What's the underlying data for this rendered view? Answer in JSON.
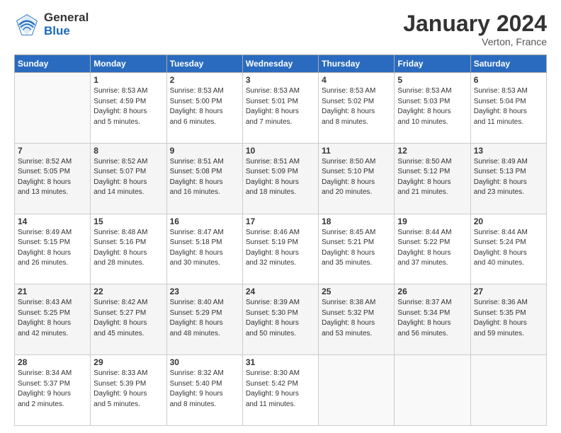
{
  "logo": {
    "general": "General",
    "blue": "Blue"
  },
  "title": "January 2024",
  "location": "Verton, France",
  "weekdays": [
    "Sunday",
    "Monday",
    "Tuesday",
    "Wednesday",
    "Thursday",
    "Friday",
    "Saturday"
  ],
  "weeks": [
    [
      {
        "day": "",
        "info": ""
      },
      {
        "day": "1",
        "info": "Sunrise: 8:53 AM\nSunset: 4:59 PM\nDaylight: 8 hours\nand 5 minutes."
      },
      {
        "day": "2",
        "info": "Sunrise: 8:53 AM\nSunset: 5:00 PM\nDaylight: 8 hours\nand 6 minutes."
      },
      {
        "day": "3",
        "info": "Sunrise: 8:53 AM\nSunset: 5:01 PM\nDaylight: 8 hours\nand 7 minutes."
      },
      {
        "day": "4",
        "info": "Sunrise: 8:53 AM\nSunset: 5:02 PM\nDaylight: 8 hours\nand 8 minutes."
      },
      {
        "day": "5",
        "info": "Sunrise: 8:53 AM\nSunset: 5:03 PM\nDaylight: 8 hours\nand 10 minutes."
      },
      {
        "day": "6",
        "info": "Sunrise: 8:53 AM\nSunset: 5:04 PM\nDaylight: 8 hours\nand 11 minutes."
      }
    ],
    [
      {
        "day": "7",
        "info": "Sunrise: 8:52 AM\nSunset: 5:05 PM\nDaylight: 8 hours\nand 13 minutes."
      },
      {
        "day": "8",
        "info": "Sunrise: 8:52 AM\nSunset: 5:07 PM\nDaylight: 8 hours\nand 14 minutes."
      },
      {
        "day": "9",
        "info": "Sunrise: 8:51 AM\nSunset: 5:08 PM\nDaylight: 8 hours\nand 16 minutes."
      },
      {
        "day": "10",
        "info": "Sunrise: 8:51 AM\nSunset: 5:09 PM\nDaylight: 8 hours\nand 18 minutes."
      },
      {
        "day": "11",
        "info": "Sunrise: 8:50 AM\nSunset: 5:10 PM\nDaylight: 8 hours\nand 20 minutes."
      },
      {
        "day": "12",
        "info": "Sunrise: 8:50 AM\nSunset: 5:12 PM\nDaylight: 8 hours\nand 21 minutes."
      },
      {
        "day": "13",
        "info": "Sunrise: 8:49 AM\nSunset: 5:13 PM\nDaylight: 8 hours\nand 23 minutes."
      }
    ],
    [
      {
        "day": "14",
        "info": "Sunrise: 8:49 AM\nSunset: 5:15 PM\nDaylight: 8 hours\nand 26 minutes."
      },
      {
        "day": "15",
        "info": "Sunrise: 8:48 AM\nSunset: 5:16 PM\nDaylight: 8 hours\nand 28 minutes."
      },
      {
        "day": "16",
        "info": "Sunrise: 8:47 AM\nSunset: 5:18 PM\nDaylight: 8 hours\nand 30 minutes."
      },
      {
        "day": "17",
        "info": "Sunrise: 8:46 AM\nSunset: 5:19 PM\nDaylight: 8 hours\nand 32 minutes."
      },
      {
        "day": "18",
        "info": "Sunrise: 8:45 AM\nSunset: 5:21 PM\nDaylight: 8 hours\nand 35 minutes."
      },
      {
        "day": "19",
        "info": "Sunrise: 8:44 AM\nSunset: 5:22 PM\nDaylight: 8 hours\nand 37 minutes."
      },
      {
        "day": "20",
        "info": "Sunrise: 8:44 AM\nSunset: 5:24 PM\nDaylight: 8 hours\nand 40 minutes."
      }
    ],
    [
      {
        "day": "21",
        "info": "Sunrise: 8:43 AM\nSunset: 5:25 PM\nDaylight: 8 hours\nand 42 minutes."
      },
      {
        "day": "22",
        "info": "Sunrise: 8:42 AM\nSunset: 5:27 PM\nDaylight: 8 hours\nand 45 minutes."
      },
      {
        "day": "23",
        "info": "Sunrise: 8:40 AM\nSunset: 5:29 PM\nDaylight: 8 hours\nand 48 minutes."
      },
      {
        "day": "24",
        "info": "Sunrise: 8:39 AM\nSunset: 5:30 PM\nDaylight: 8 hours\nand 50 minutes."
      },
      {
        "day": "25",
        "info": "Sunrise: 8:38 AM\nSunset: 5:32 PM\nDaylight: 8 hours\nand 53 minutes."
      },
      {
        "day": "26",
        "info": "Sunrise: 8:37 AM\nSunset: 5:34 PM\nDaylight: 8 hours\nand 56 minutes."
      },
      {
        "day": "27",
        "info": "Sunrise: 8:36 AM\nSunset: 5:35 PM\nDaylight: 8 hours\nand 59 minutes."
      }
    ],
    [
      {
        "day": "28",
        "info": "Sunrise: 8:34 AM\nSunset: 5:37 PM\nDaylight: 9 hours\nand 2 minutes."
      },
      {
        "day": "29",
        "info": "Sunrise: 8:33 AM\nSunset: 5:39 PM\nDaylight: 9 hours\nand 5 minutes."
      },
      {
        "day": "30",
        "info": "Sunrise: 8:32 AM\nSunset: 5:40 PM\nDaylight: 9 hours\nand 8 minutes."
      },
      {
        "day": "31",
        "info": "Sunrise: 8:30 AM\nSunset: 5:42 PM\nDaylight: 9 hours\nand 11 minutes."
      },
      {
        "day": "",
        "info": ""
      },
      {
        "day": "",
        "info": ""
      },
      {
        "day": "",
        "info": ""
      }
    ]
  ]
}
